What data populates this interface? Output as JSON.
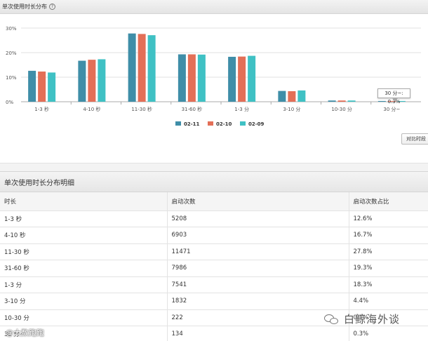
{
  "header": {
    "title": "单次使用时长分布"
  },
  "chart_data": {
    "type": "bar",
    "categories": [
      "1-3 秒",
      "4-10 秒",
      "11-30 秒",
      "31-60 秒",
      "1-3 分",
      "3-10 分",
      "10-30 分",
      "30 分~"
    ],
    "series": [
      {
        "name": "02-11",
        "color": "#3f8ea8",
        "values": [
          12.6,
          16.7,
          27.8,
          19.3,
          18.3,
          4.4,
          0.5,
          0.3
        ]
      },
      {
        "name": "02-10",
        "color": "#e36f57",
        "values": [
          12.3,
          17.1,
          27.6,
          19.3,
          18.4,
          4.3,
          0.5,
          0.3
        ]
      },
      {
        "name": "02-09",
        "color": "#3fc1c4",
        "values": [
          11.9,
          17.3,
          27.1,
          19.2,
          18.7,
          4.6,
          0.5,
          0.3
        ]
      }
    ],
    "yticks": [
      "0%",
      "10%",
      "20%",
      "30%"
    ],
    "ylim": [
      0,
      30
    ],
    "grid": true,
    "legend_position": "bottom"
  },
  "tooltip": {
    "text": "30 分~: 0.3%"
  },
  "compare_button": {
    "label": "对比时段"
  },
  "detail": {
    "title": "单次使用时长分布明细",
    "columns": [
      "时长",
      "启动次数",
      "启动次数占比"
    ],
    "rows": [
      [
        "1-3 秒",
        "5208",
        "12.6%"
      ],
      [
        "4-10 秒",
        "6903",
        "16.7%"
      ],
      [
        "11-30 秒",
        "11471",
        "27.8%"
      ],
      [
        "31-60 秒",
        "7986",
        "19.3%"
      ],
      [
        "1-3 分",
        "7541",
        "18.3%"
      ],
      [
        "3-10 分",
        "1832",
        "4.4%"
      ],
      [
        "10-30 分",
        "222",
        "0.5%"
      ],
      [
        "30 分~",
        "134",
        "0.3%"
      ]
    ]
  },
  "watermarks": {
    "left": "@大数跑跑",
    "right": "白鲸海外谈"
  }
}
